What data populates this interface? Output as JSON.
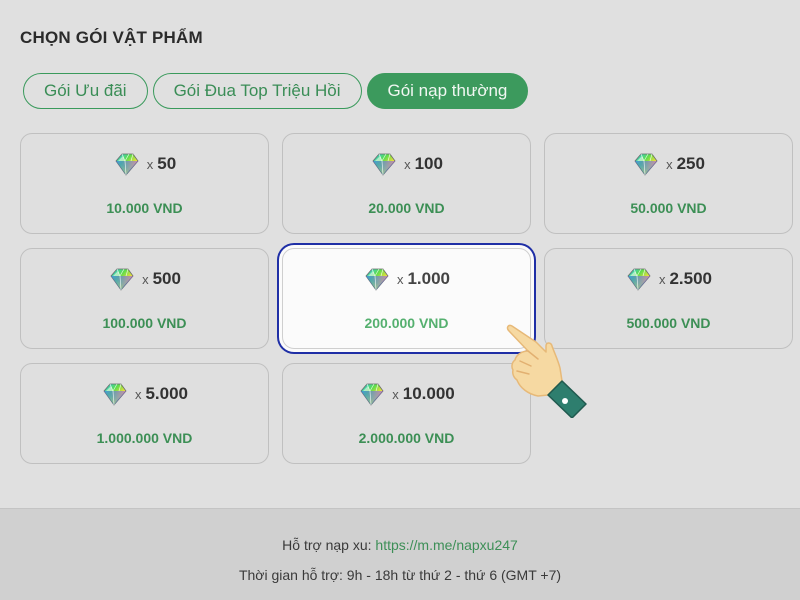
{
  "section_title": "CHỌN GÓI VẬT PHẨM",
  "tabs": [
    {
      "label": "Gói Ưu đãi",
      "active": false
    },
    {
      "label": "Gói Đua Top Triệu Hồi",
      "active": false
    },
    {
      "label": "Gói nạp thường",
      "active": true
    }
  ],
  "multiplier": "x",
  "packages": [
    {
      "amount": "50",
      "price": "10.000 VND",
      "selected": false
    },
    {
      "amount": "100",
      "price": "20.000 VND",
      "selected": false
    },
    {
      "amount": "250",
      "price": "50.000 VND",
      "selected": false
    },
    {
      "amount": "500",
      "price": "100.000 VND",
      "selected": false
    },
    {
      "amount": "1.000",
      "price": "200.000 VND",
      "selected": true
    },
    {
      "amount": "2.500",
      "price": "500.000 VND",
      "selected": false
    },
    {
      "amount": "5.000",
      "price": "1.000.000 VND",
      "selected": false
    },
    {
      "amount": "10.000",
      "price": "2.000.000 VND",
      "selected": false
    }
  ],
  "footer": {
    "support_label": "Hỗ trợ nạp xu: ",
    "support_link": "https://m.me/napxu247",
    "hours": "Thời gian hỗ trợ: 9h - 18h từ thứ 2 - thứ 6 (GMT +7)"
  },
  "icons": {
    "gem": "diamond-gem-icon",
    "pointer": "pointing-hand-icon"
  },
  "colors": {
    "accent_green": "#3c9a5d",
    "selection_outline": "#1f2fa6"
  }
}
